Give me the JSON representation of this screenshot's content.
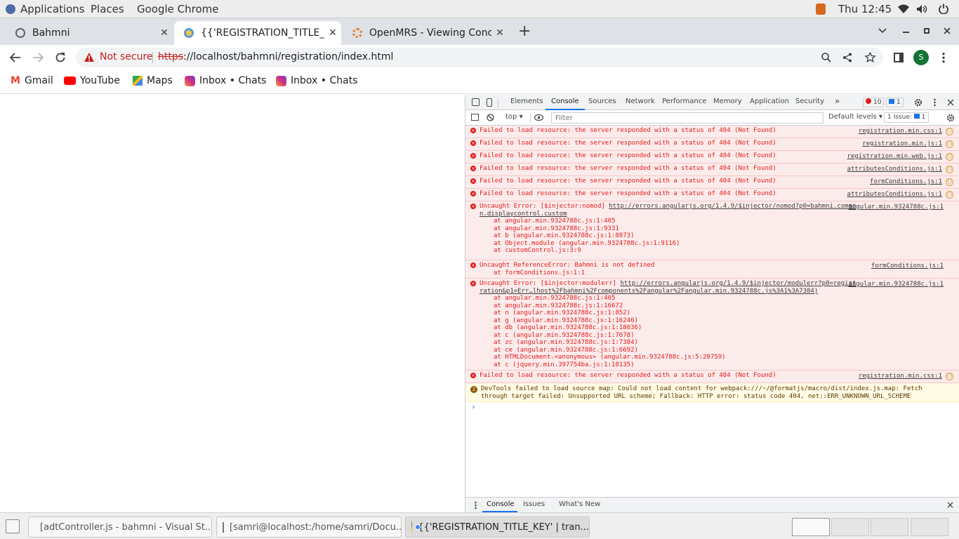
{
  "gnome": {
    "applications": "Applications",
    "places": "Places",
    "app": "Google Chrome",
    "clock": "Thu 12:45"
  },
  "tabs": [
    {
      "title": "Bahmni",
      "close": "✕"
    },
    {
      "title": "{{'REGISTRATION_TITLE_K",
      "close": "✕"
    },
    {
      "title": "OpenMRS - Viewing Conce",
      "close": "✕"
    }
  ],
  "new_tab": "+",
  "address": {
    "security": "Not secure",
    "scheme": "https",
    "url_rest": "://localhost/bahmni/registration/index.html",
    "profile": "S"
  },
  "bookmarks": [
    "Gmail",
    "YouTube",
    "Maps",
    "Inbox • Chats",
    "Inbox • Chats"
  ],
  "devtools": {
    "tabs": [
      "Elements",
      "Console",
      "Sources",
      "Network",
      "Performance",
      "Memory",
      "Application",
      "Security"
    ],
    "more": "»",
    "errors": "10",
    "issues_badge": "1",
    "context": "top ▾",
    "filter_placeholder": "Filter",
    "levels": "Default levels ▾",
    "issue_count": "1 Issue:",
    "issue_num": "1",
    "messages": [
      {
        "text": "Failed to load resource: the server responded with a status of 404 (Not Found)",
        "src": "registration.min.css:1"
      },
      {
        "text": "Failed to load resource: the server responded with a status of 404 (Not Found)",
        "src": "registration.min.js:1"
      },
      {
        "text": "Failed to load resource: the server responded with a status of 404 (Not Found)",
        "src": "registration.min.web.js:1"
      },
      {
        "text": "Failed to load resource: the server responded with a status of 404 (Not Found)",
        "src": "attributesConditions.js:1"
      },
      {
        "text": "Failed to load resource: the server responded with a status of 404 (Not Found)",
        "src": "formConditions.js:1"
      },
      {
        "text": "Failed to load resource: the server responded with a status of 404 (Not Found)",
        "src": "attributesConditions.js:1"
      }
    ],
    "error1": {
      "head": "Uncaught Error: [$injector:nomod] ",
      "link": "http://errors.angularjs.org/1.4.9/$injector/nomod?p0=bahmni.commo",
      "cont": "n.displaycontrol.custom",
      "src": "angular.min.9324788c.js:1",
      "stack": [
        "at angular.min.9324788c.js:1:405",
        "at angular.min.9324788c.js:1:9331",
        "at b (angular.min.9324788c.js:1:8873)",
        "at Object.module (angular.min.9324788c.js:1:9116)",
        "at customControl.js:3:9"
      ]
    },
    "error2": {
      "head": "Uncaught ReferenceError: Bahmni is not defined",
      "src": "formConditions.js:1",
      "stack": [
        "at formConditions.js:1:1"
      ]
    },
    "error3": {
      "head": "Uncaught Error: [$injector:modulerr] ",
      "link": "http://errors.angularjs.org/1.4.9/$injector/modulerr?p0=regist",
      "cont": "ration&p1=Err…lhost%2Fbahmni%2Fcomponents%2Fangular%2Fangular.min.9324788c.js%3A1%3A7384)",
      "src": "angular.min.9324788c.js:1",
      "stack": [
        "at angular.min.9324788c.js:1:405",
        "at angular.min.9324788c.js:1:16672",
        "at n (angular.min.9324788c.js:1:852)",
        "at g (angular.min.9324788c.js:1:16246)",
        "at db (angular.min.9324788c.js:1:18036)",
        "at c (angular.min.9324788c.js:1:7078)",
        "at zc (angular.min.9324788c.js:1:7384)",
        "at ce (angular.min.9324788c.js:1:6692)",
        "at HTMLDocument.<anonymous> (angular.min.9324788c.js:5:20759)",
        "at c (jquery.min.397754ba.js:1:18135)"
      ]
    },
    "last404": {
      "text": "Failed to load resource: the server responded with a status of 404 (Not Found)",
      "src": "registration.min.css:1"
    },
    "warning": {
      "count": "2",
      "text": "DevTools failed to load source map: Could not load content for webpack:///~/@formatjs/macro/dist/index.js.map: Fetch through target failed: Unsupported URL scheme; Fallback: HTTP error: status code 404, net::ERR_UNKNOWN_URL_SCHEME"
    },
    "prompt": "›",
    "drawer": [
      "Console",
      "Issues",
      "What's New"
    ]
  },
  "taskbar": [
    {
      "label": "[adtController.js - bahmni - Visual St..."
    },
    {
      "label": "[samri@localhost:/home/samri/Docu..."
    },
    {
      "label": "{{'REGISTRATION_TITLE_KEY' | tran..."
    }
  ]
}
